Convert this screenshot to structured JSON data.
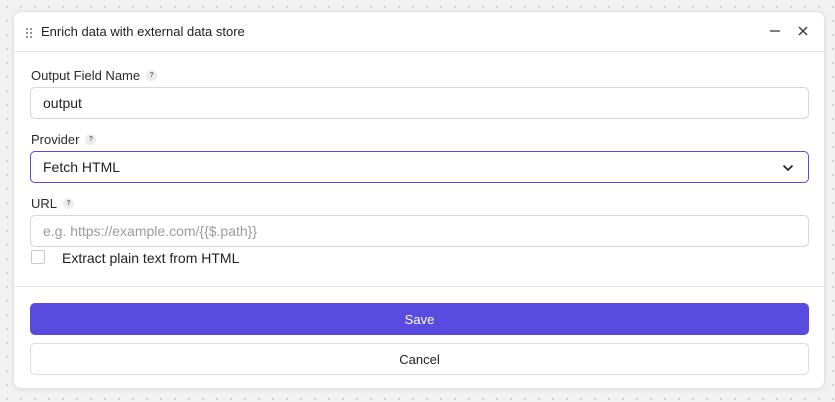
{
  "dialog": {
    "title": "Enrich data with external data store"
  },
  "fields": {
    "output_field": {
      "label": "Output Field Name",
      "help": "?",
      "value": "output"
    },
    "provider": {
      "label": "Provider",
      "help": "?",
      "selected": "Fetch HTML"
    },
    "url": {
      "label": "URL",
      "help": "?",
      "value": "",
      "placeholder": "e.g. https://example.com/{{$.path}}"
    },
    "extract_plain_text": {
      "label": "Extract plain text from HTML",
      "checked": false
    }
  },
  "actions": {
    "save_label": "Save",
    "cancel_label": "Cancel"
  },
  "colors": {
    "accent": "#5a4be0",
    "focus_border": "#5a4bd6",
    "background": "#f1f1f1"
  },
  "icons": {
    "drag": "drag-handle-icon",
    "minimize": "minus-icon",
    "close": "close-icon",
    "chevron": "chevron-down-icon",
    "help": "help-icon"
  }
}
